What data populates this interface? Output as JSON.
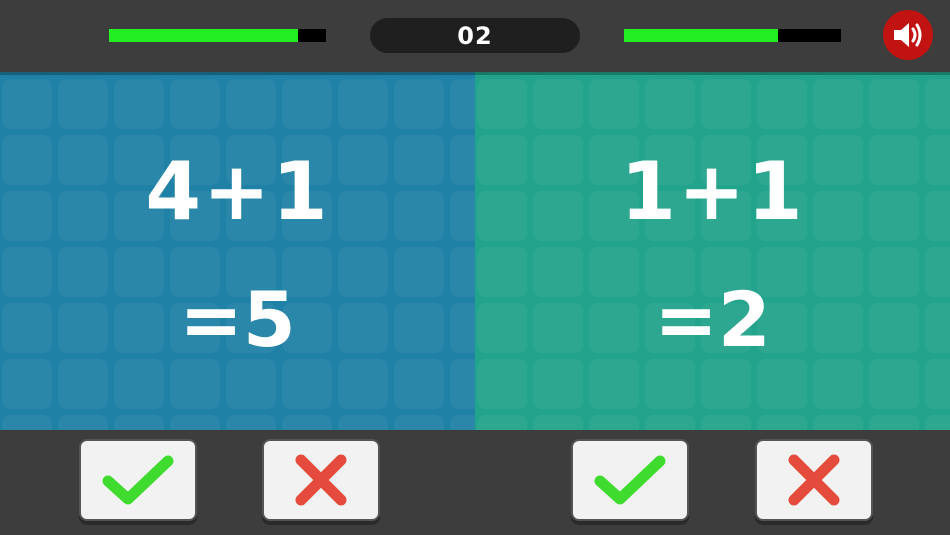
{
  "header": {
    "score": "02",
    "timer_left_level": 0.87,
    "timer_right_level": 0.71,
    "sound_icon": "speaker-volume-icon"
  },
  "left_panel": {
    "expression": "4+1",
    "result": "=5",
    "color": "#1f81a6"
  },
  "right_panel": {
    "expression": "1+1",
    "result": "=2",
    "color": "#22a38b"
  },
  "buttons": {
    "correct_icon": "checkmark-icon",
    "wrong_icon": "cross-icon",
    "correct_color": "#3fdc2f",
    "wrong_color": "#e54b3c"
  }
}
